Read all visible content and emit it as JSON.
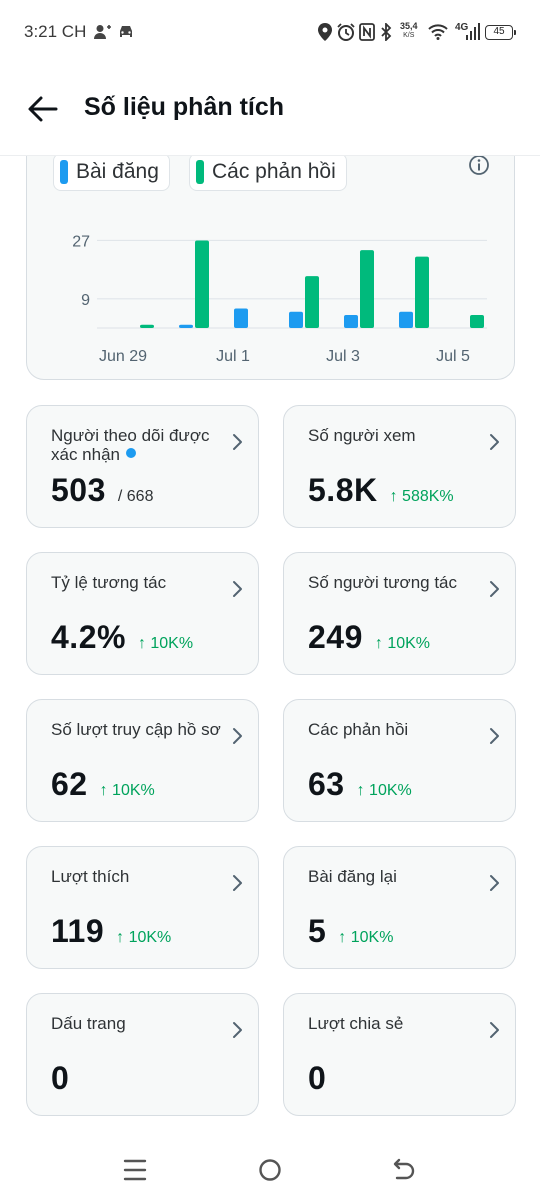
{
  "status_bar": {
    "time": "3:21 CH",
    "net_speed_value": "35,4",
    "net_speed_unit": "K/S",
    "network_type": "4G",
    "battery": "45"
  },
  "header": {
    "title": "Số liệu phân tích"
  },
  "chart": {
    "legend": [
      {
        "label": "Bài đăng",
        "color": "#1d9bf0"
      },
      {
        "label": "Các phản hồi",
        "color": "#00ba7c"
      }
    ],
    "info_icon": "info-icon"
  },
  "chart_data": {
    "type": "bar",
    "categories": [
      "Jun 29",
      "Jun 30",
      "Jul 1",
      "Jul 2",
      "Jul 3",
      "Jul 4",
      "Jul 5"
    ],
    "x_tick_labels": [
      "Jun 29",
      "Jul 1",
      "Jul 3",
      "Jul 5"
    ],
    "y_tick_labels": [
      "27",
      "9"
    ],
    "ylim": [
      0,
      33
    ],
    "grid": true,
    "legend_position": "top-left",
    "series": [
      {
        "name": "Bài đăng",
        "color": "#1d9bf0",
        "values": [
          0,
          1,
          6,
          5,
          4,
          5,
          0
        ]
      },
      {
        "name": "Các phản hồi",
        "color": "#00ba7c",
        "values": [
          1,
          27,
          0,
          16,
          24,
          22,
          4
        ]
      }
    ]
  },
  "metrics": [
    {
      "label": "Người theo dõi được xác nhận",
      "value": "503",
      "total": "/ 668",
      "change": "",
      "verified": true
    },
    {
      "label": "Số người xem",
      "value": "5.8K",
      "total": "",
      "change": "↑ 588K%"
    },
    {
      "label": "Tỷ lệ tương tác",
      "value": "4.2%",
      "total": "",
      "change": "↑ 10K%"
    },
    {
      "label": "Số người tương tác",
      "value": "249",
      "total": "",
      "change": "↑ 10K%"
    },
    {
      "label": "Số lượt truy cập hồ sơ",
      "value": "62",
      "total": "",
      "change": "↑ 10K%"
    },
    {
      "label": "Các phản hồi",
      "value": "63",
      "total": "",
      "change": "↑ 10K%"
    },
    {
      "label": "Lượt thích",
      "value": "119",
      "total": "",
      "change": "↑ 10K%"
    },
    {
      "label": "Bài đăng lại",
      "value": "5",
      "total": "",
      "change": "↑ 10K%"
    },
    {
      "label": "Dấu trang",
      "value": "0",
      "total": "",
      "change": ""
    },
    {
      "label": "Lượt chia sẻ",
      "value": "0",
      "total": "",
      "change": ""
    }
  ],
  "nav_bar": {
    "icons": [
      "recent-apps-icon",
      "home-icon",
      "back-icon"
    ]
  }
}
